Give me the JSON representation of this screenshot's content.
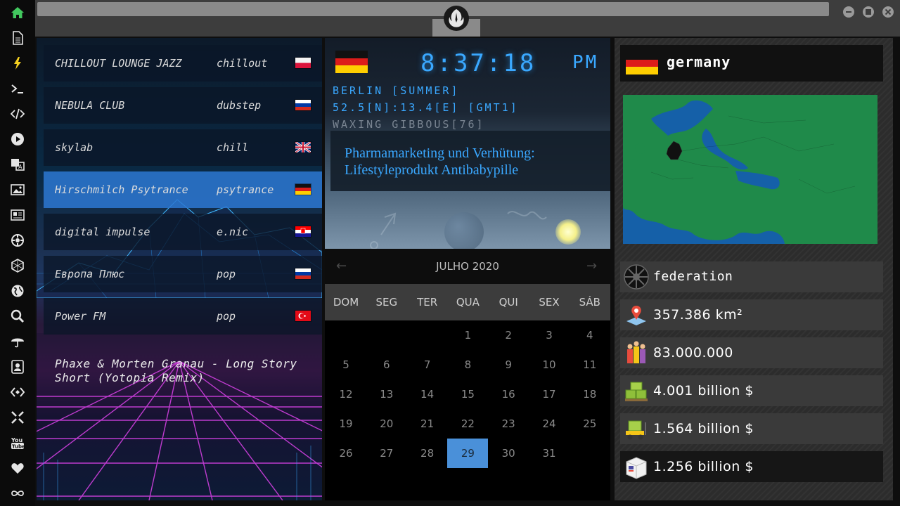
{
  "dock": {
    "items": [
      "home",
      "file",
      "flash",
      "terminal",
      "code",
      "play",
      "translate",
      "image",
      "news",
      "settings",
      "hexagon",
      "globe",
      "search",
      "umbrella",
      "contact",
      "tag",
      "fullscreen",
      "youtube",
      "heart",
      "infinity"
    ]
  },
  "radio": {
    "stations": [
      {
        "name": "CHILLOUT LOUNGE JAZZ",
        "genre": "chillout",
        "flag": "poland",
        "active": false
      },
      {
        "name": "NEBULA CLUB",
        "genre": "dubstep",
        "flag": "russia",
        "active": false
      },
      {
        "name": "skylab",
        "genre": "chill",
        "flag": "uk",
        "active": false
      },
      {
        "name": "Hirschmilch Psytrance",
        "genre": "psytrance",
        "flag": "germany",
        "active": true
      },
      {
        "name": "digital impulse",
        "genre": "e.nic",
        "flag": "croatia",
        "active": false
      },
      {
        "name": "Европа Плюс",
        "genre": "pop",
        "flag": "russia",
        "active": false
      },
      {
        "name": "Power FM",
        "genre": "pop",
        "flag": "turkey",
        "active": false
      }
    ],
    "now_playing": "Phaxe & Morten Granau - Long Story Short (Yotopia Remix)"
  },
  "clock": {
    "time": "8:37:18",
    "ampm": "PM",
    "city": "BERLIN [SUMMER]",
    "coords": "52.5[N]:13.4[E] [GMT1]",
    "moon": "WAXING GIBBOUS[76]",
    "headline": "Pharmamarketing und Verhütung: Lifestyleprodukt Antibabypille"
  },
  "calendar": {
    "month_title": "JULHO 2020",
    "prev": "←",
    "next": "→",
    "weekdays": [
      "DOM",
      "SEG",
      "TER",
      "QUA",
      "QUI",
      "SEX",
      "SÁB"
    ],
    "first_weekday": 3,
    "days_in_month": 31,
    "today": 29
  },
  "country": {
    "name": "germany",
    "government": "federation",
    "area": "357.386 km²",
    "population": "83.000.000",
    "gdp": "4.001 billion $",
    "exports": "1.564 billion $",
    "imports": "1.256 billion $"
  },
  "colors": {
    "accent": "#3aa8ff",
    "active_station": "#2d78d2",
    "today": "#4a90d9",
    "map_land": "#1f8a4a",
    "map_sea": "#1560a8"
  }
}
